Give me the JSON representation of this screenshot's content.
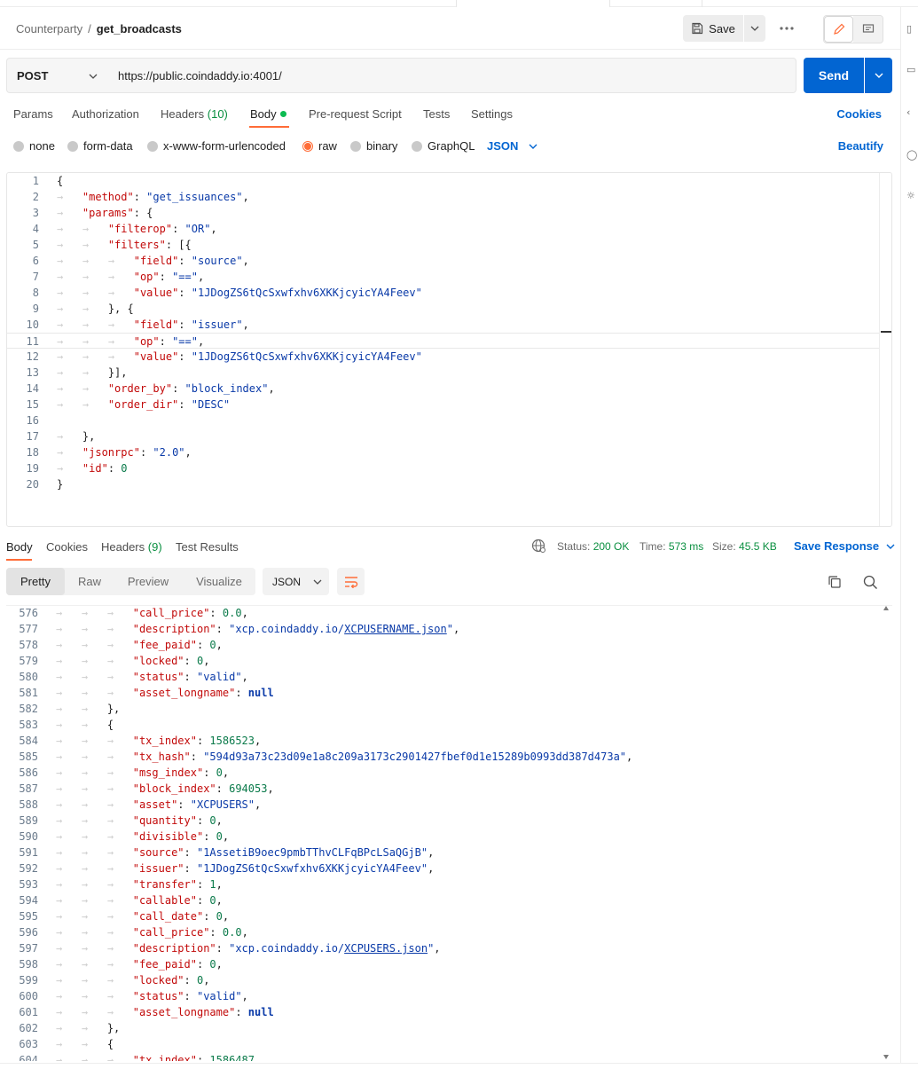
{
  "breadcrumb": {
    "parent": "Counterparty",
    "separator": "/",
    "current": "get_broadcasts"
  },
  "header": {
    "save_label": "Save"
  },
  "request": {
    "method": "POST",
    "url": "https://public.coindaddy.io:4001/",
    "send_label": "Send"
  },
  "request_tabs": {
    "params": "Params",
    "authorization": "Authorization",
    "headers": "Headers",
    "headers_count": "(10)",
    "body": "Body",
    "pre_request": "Pre-request Script",
    "tests": "Tests",
    "settings": "Settings",
    "cookies": "Cookies"
  },
  "body_types": {
    "none": "none",
    "form_data": "form-data",
    "urlencoded": "x-www-form-urlencoded",
    "raw": "raw",
    "binary": "binary",
    "graphql": "GraphQL",
    "language": "JSON",
    "beautify": "Beautify",
    "selected": "raw"
  },
  "request_body_lines": [
    {
      "n": "1",
      "t": "{"
    },
    {
      "n": "2",
      "t": "    \"method\": \"get_issuances\","
    },
    {
      "n": "3",
      "t": "    \"params\": {"
    },
    {
      "n": "4",
      "t": "        \"filterop\": \"OR\","
    },
    {
      "n": "5",
      "t": "        \"filters\": [{"
    },
    {
      "n": "6",
      "t": "            \"field\": \"source\","
    },
    {
      "n": "7",
      "t": "            \"op\": \"==\","
    },
    {
      "n": "8",
      "t": "            \"value\": \"1JDogZS6tQcSxwfxhv6XKKjcyicYA4Feev\""
    },
    {
      "n": "9",
      "t": "        }, {"
    },
    {
      "n": "10",
      "t": "            \"field\": \"issuer\","
    },
    {
      "n": "11",
      "t": "            \"op\": \"==\","
    },
    {
      "n": "12",
      "t": "            \"value\": \"1JDogZS6tQcSxwfxhv6XKKjcyicYA4Feev\""
    },
    {
      "n": "13",
      "t": "        }],"
    },
    {
      "n": "14",
      "t": "        \"order_by\": \"block_index\","
    },
    {
      "n": "15",
      "t": "        \"order_dir\": \"DESC\""
    },
    {
      "n": "16",
      "t": ""
    },
    {
      "n": "17",
      "t": "    },"
    },
    {
      "n": "18",
      "t": "    \"jsonrpc\": \"2.0\","
    },
    {
      "n": "19",
      "t": "    \"id\": 0"
    },
    {
      "n": "20",
      "t": "}"
    }
  ],
  "response_tabs": {
    "body": "Body",
    "cookies": "Cookies",
    "headers": "Headers",
    "headers_count": "(9)",
    "test_results": "Test Results"
  },
  "response_meta": {
    "status_label": "Status:",
    "status_value": "200 OK",
    "time_label": "Time:",
    "time_value": "573 ms",
    "size_label": "Size:",
    "size_value": "45.5 KB",
    "save_response": "Save Response"
  },
  "view_modes": {
    "pretty": "Pretty",
    "raw": "Raw",
    "preview": "Preview",
    "visualize": "Visualize",
    "format": "JSON"
  },
  "response_lines": [
    {
      "n": "576",
      "t": "            \"call_price\": 0.0,"
    },
    {
      "n": "577",
      "t": "            \"description\": \"xcp.coindaddy.io/XCPUSERNAME.json\","
    },
    {
      "n": "578",
      "t": "            \"fee_paid\": 0,"
    },
    {
      "n": "579",
      "t": "            \"locked\": 0,"
    },
    {
      "n": "580",
      "t": "            \"status\": \"valid\","
    },
    {
      "n": "581",
      "t": "            \"asset_longname\": null"
    },
    {
      "n": "582",
      "t": "        },"
    },
    {
      "n": "583",
      "t": "        {"
    },
    {
      "n": "584",
      "t": "            \"tx_index\": 1586523,"
    },
    {
      "n": "585",
      "t": "            \"tx_hash\": \"594d93a73c23d09e1a8c209a3173c2901427fbef0d1e15289b0993dd387d473a\","
    },
    {
      "n": "586",
      "t": "            \"msg_index\": 0,"
    },
    {
      "n": "587",
      "t": "            \"block_index\": 694053,"
    },
    {
      "n": "588",
      "t": "            \"asset\": \"XCPUSERS\","
    },
    {
      "n": "589",
      "t": "            \"quantity\": 0,"
    },
    {
      "n": "590",
      "t": "            \"divisible\": 0,"
    },
    {
      "n": "591",
      "t": "            \"source\": \"1AssetiB9oec9pmbTThvCLFqBPcLSaQGjB\","
    },
    {
      "n": "592",
      "t": "            \"issuer\": \"1JDogZS6tQcSxwfxhv6XKKjcyicYA4Feev\","
    },
    {
      "n": "593",
      "t": "            \"transfer\": 1,"
    },
    {
      "n": "594",
      "t": "            \"callable\": 0,"
    },
    {
      "n": "595",
      "t": "            \"call_date\": 0,"
    },
    {
      "n": "596",
      "t": "            \"call_price\": 0.0,"
    },
    {
      "n": "597",
      "t": "            \"description\": \"xcp.coindaddy.io/XCPUSERS.json\","
    },
    {
      "n": "598",
      "t": "            \"fee_paid\": 0,"
    },
    {
      "n": "599",
      "t": "            \"locked\": 0,"
    },
    {
      "n": "600",
      "t": "            \"status\": \"valid\","
    },
    {
      "n": "601",
      "t": "            \"asset_longname\": null"
    },
    {
      "n": "602",
      "t": "        },"
    },
    {
      "n": "603",
      "t": "        {"
    },
    {
      "n": "604",
      "t": "            \"tx_index\": 1586487,"
    }
  ],
  "colors": {
    "accent": "#ff6c37",
    "primary": "#0265d2",
    "success": "#0a8f40",
    "json_key": "#c20a0a",
    "json_string": "#0a3aa8",
    "json_number": "#0a7a4a"
  },
  "icons": {
    "save": "save-icon",
    "more": "more-icon",
    "edit": "pencil-icon",
    "comments": "comment-icon",
    "globe": "globe-icon",
    "wrap": "wrap-lines-icon",
    "copy": "copy-icon",
    "search": "search-icon"
  }
}
